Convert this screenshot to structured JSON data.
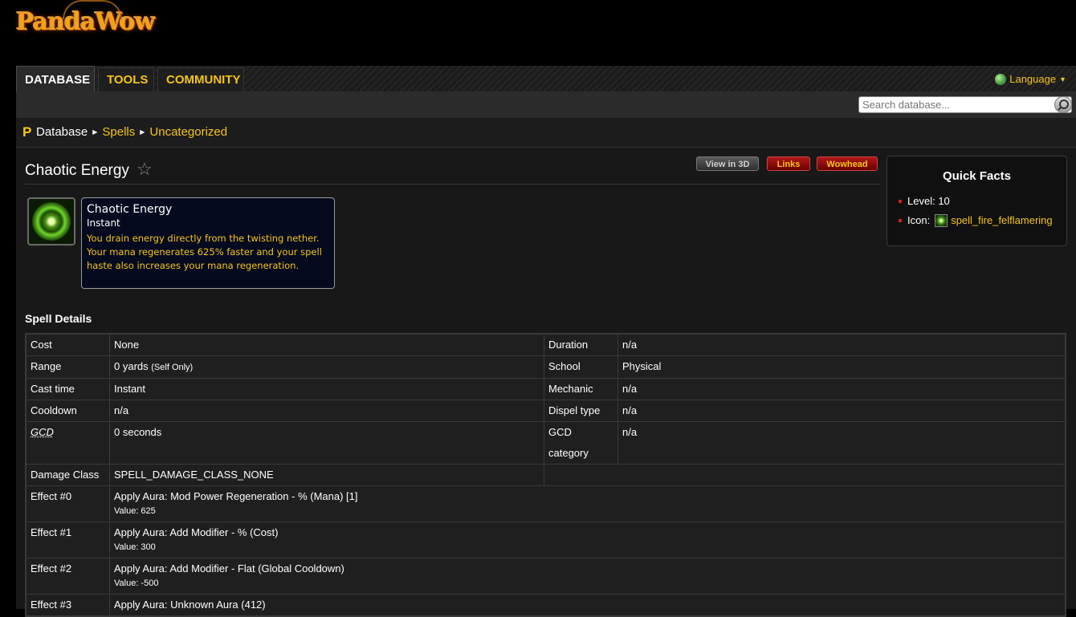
{
  "logo": {
    "text": "PandaWow"
  },
  "nav": {
    "tabs": [
      {
        "label": "DATABASE"
      },
      {
        "label": "TOOLS"
      },
      {
        "label": "COMMUNITY"
      }
    ],
    "language_label": "Language"
  },
  "search": {
    "placeholder": "Search database..."
  },
  "breadcrumb": {
    "logo_letter": "P",
    "items": [
      "Database",
      "Spells",
      "Uncategorized"
    ]
  },
  "page": {
    "title": "Chaotic Energy",
    "buttons": {
      "view3d": "View in 3D",
      "links": "Links",
      "wowhead": "Wowhead"
    }
  },
  "tooltip": {
    "name": "Chaotic Energy",
    "cast": "Instant",
    "description": "You drain energy directly from the twisting nether. Your mana regenerates 625% faster and your spell haste also increases your mana regeneration."
  },
  "quick_facts": {
    "title": "Quick Facts",
    "level_label": "Level:",
    "level_value": "10",
    "icon_label": "Icon:",
    "icon_name": "spell_fire_felflamering"
  },
  "spell_details": {
    "title": "Spell Details",
    "rows": [
      {
        "label": "Cost",
        "value": "None",
        "label2": "Duration",
        "value2": "n/a"
      },
      {
        "label": "Range",
        "value": "0 yards",
        "value_note": "(Self Only)",
        "label2": "School",
        "value2": "Physical"
      },
      {
        "label": "Cast time",
        "value": "Instant",
        "label2": "Mechanic",
        "value2": "n/a"
      },
      {
        "label": "Cooldown",
        "value": "n/a",
        "label2": "Dispel type",
        "value2": "n/a"
      },
      {
        "label": "GCD",
        "value": "0 seconds",
        "label2": "GCD category",
        "value2": "n/a"
      },
      {
        "label": "Damage Class",
        "value": "SPELL_DAMAGE_CLASS_NONE"
      }
    ],
    "effects": [
      {
        "label": "Effect #0",
        "value": "Apply Aura: Mod Power Regeneration - % (Mana) [1]",
        "detail": "Value: 625"
      },
      {
        "label": "Effect #1",
        "value": "Apply Aura: Add Modifier - % (Cost)",
        "detail": "Value: 300"
      },
      {
        "label": "Effect #2",
        "value": "Apply Aura: Add Modifier - Flat (Global Cooldown)",
        "detail": "Value: -500"
      },
      {
        "label": "Effect #3",
        "value": "Apply Aura: Unknown Aura (412)"
      }
    ]
  }
}
